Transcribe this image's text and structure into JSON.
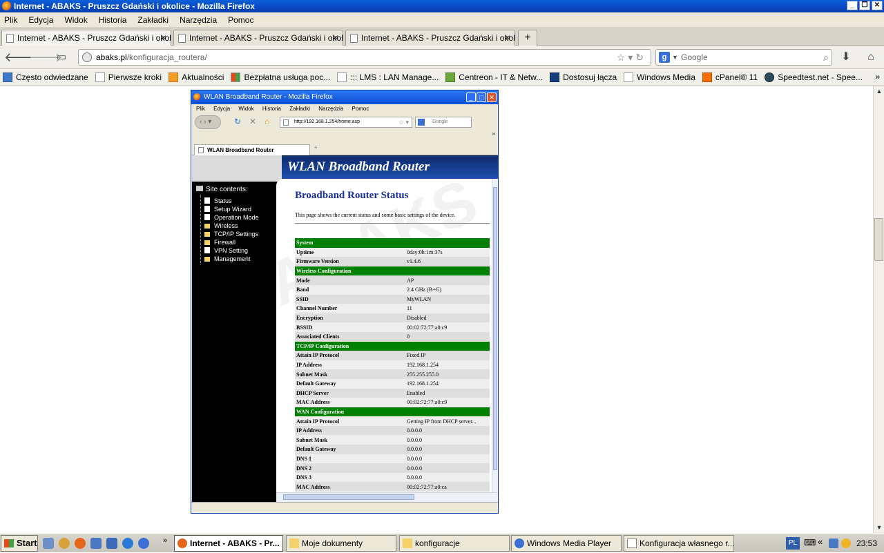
{
  "window": {
    "title": "Internet - ABAKS - Pruszcz Gdański i okolice - Mozilla Firefox"
  },
  "menu": [
    "Plik",
    "Edycja",
    "Widok",
    "Historia",
    "Zakładki",
    "Narzędzia",
    "Pomoc"
  ],
  "tabs": [
    {
      "label": "Internet - ABAKS - Pruszcz Gdański i okoli..."
    },
    {
      "label": "Internet - ABAKS - Pruszcz Gdański i okoli..."
    },
    {
      "label": "Internet - ABAKS - Pruszcz Gdański i okoli..."
    }
  ],
  "nav": {
    "url_domain": "abaks.pl",
    "url_path": "/konfiguracja_routera/",
    "search_placeholder": "Google"
  },
  "bookmarks": [
    {
      "label": "Często odwiedzane",
      "icon": "blue"
    },
    {
      "label": "Pierwsze kroki",
      "icon": "page"
    },
    {
      "label": "Aktualności",
      "icon": "orange"
    },
    {
      "label": "Bezpłatna usługa poc...",
      "icon": "ms"
    },
    {
      "label": "::: LMS : LAN Manage...",
      "icon": "page"
    },
    {
      "label": "Centreon - IT & Netw...",
      "icon": "green"
    },
    {
      "label": "Dostosuj łącza",
      "icon": "navy"
    },
    {
      "label": "Windows Media",
      "icon": "page"
    },
    {
      "label": "cPanel® 11",
      "icon": "cp"
    },
    {
      "label": "Speedtest.net - Spee...",
      "icon": "dark"
    }
  ],
  "screenshot": {
    "title": "WLAN Broadband Router - Mozilla Firefox",
    "menu": [
      "Plik",
      "Edycja",
      "Widok",
      "Historia",
      "Zakładki",
      "Narzędzia",
      "Pomoc"
    ],
    "url": "http://192.168.1.254/home.asp",
    "search": "Google",
    "tab": "WLAN Broadband Router",
    "banner": "WLAN Broadband Router",
    "site_contents": "Site contents:",
    "sidebar": [
      {
        "label": "Status",
        "type": "page"
      },
      {
        "label": "Setup Wizard",
        "type": "page"
      },
      {
        "label": "Operation Mode",
        "type": "page"
      },
      {
        "label": "Wireless",
        "type": "folder"
      },
      {
        "label": "TCP/IP Settings",
        "type": "folder"
      },
      {
        "label": "Firewall",
        "type": "folder"
      },
      {
        "label": "VPN Setting",
        "type": "page"
      },
      {
        "label": "Management",
        "type": "folder"
      }
    ],
    "heading": "Broadband Router Status",
    "description": "This page shows the current status and some basic settings of the device.",
    "watermark": "ABAKS",
    "sections": [
      {
        "title": "System",
        "rows": [
          {
            "label": "Uptime",
            "value": "0day:0h:1m:37s"
          },
          {
            "label": "Firmware Version",
            "value": "v1.4.6"
          }
        ]
      },
      {
        "title": "Wireless Configuration",
        "rows": [
          {
            "label": "Mode",
            "value": "AP"
          },
          {
            "label": "Band",
            "value": "2.4 GHz (B+G)"
          },
          {
            "label": "SSID",
            "value": "MyWLAN"
          },
          {
            "label": "Channel Number",
            "value": "11"
          },
          {
            "label": "Encryption",
            "value": "Disabled"
          },
          {
            "label": "BSSID",
            "value": "00:02:72:77:a0:c9"
          },
          {
            "label": "Associated Clients",
            "value": "0"
          }
        ]
      },
      {
        "title": "TCP/IP Configuration",
        "rows": [
          {
            "label": "Attain IP Protocol",
            "value": "Fixed IP"
          },
          {
            "label": "IP Address",
            "value": "192.168.1.254"
          },
          {
            "label": "Subnet Mask",
            "value": "255.255.255.0"
          },
          {
            "label": "Default Gateway",
            "value": "192.168.1.254"
          },
          {
            "label": "DHCP Server",
            "value": "Enabled"
          },
          {
            "label": "MAC Address",
            "value": "00:02:72:77:a0:c9"
          }
        ]
      },
      {
        "title": "WAN Configuration",
        "rows": [
          {
            "label": "Attain IP Protocol",
            "value": "Getting IP from DHCP server..."
          },
          {
            "label": "IP Address",
            "value": "0.0.0.0"
          },
          {
            "label": "Subnet Mask",
            "value": "0.0.0.0"
          },
          {
            "label": "Default Gateway",
            "value": "0.0.0.0"
          },
          {
            "label": "DNS 1",
            "value": "0.0.0.0"
          },
          {
            "label": "DNS 2",
            "value": "0.0.0.0"
          },
          {
            "label": "DNS 3",
            "value": "0.0.0.0"
          },
          {
            "label": "MAC Address",
            "value": "00:02:72:77:a0:ca"
          }
        ]
      }
    ]
  },
  "taskbar": {
    "start": "Start",
    "buttons": [
      {
        "label": "Internet - ABAKS - Pr...",
        "active": true,
        "icon": "firefox"
      },
      {
        "label": "Moje dokumenty",
        "active": false,
        "icon": "folder"
      },
      {
        "label": "konfiguracje",
        "active": false,
        "icon": "folder"
      },
      {
        "label": "Windows Media Player",
        "active": false,
        "icon": "wmp"
      },
      {
        "label": "Konfiguracja własnego r...",
        "active": false,
        "icon": "doc"
      }
    ],
    "language": "PL",
    "clock": "23:53"
  }
}
